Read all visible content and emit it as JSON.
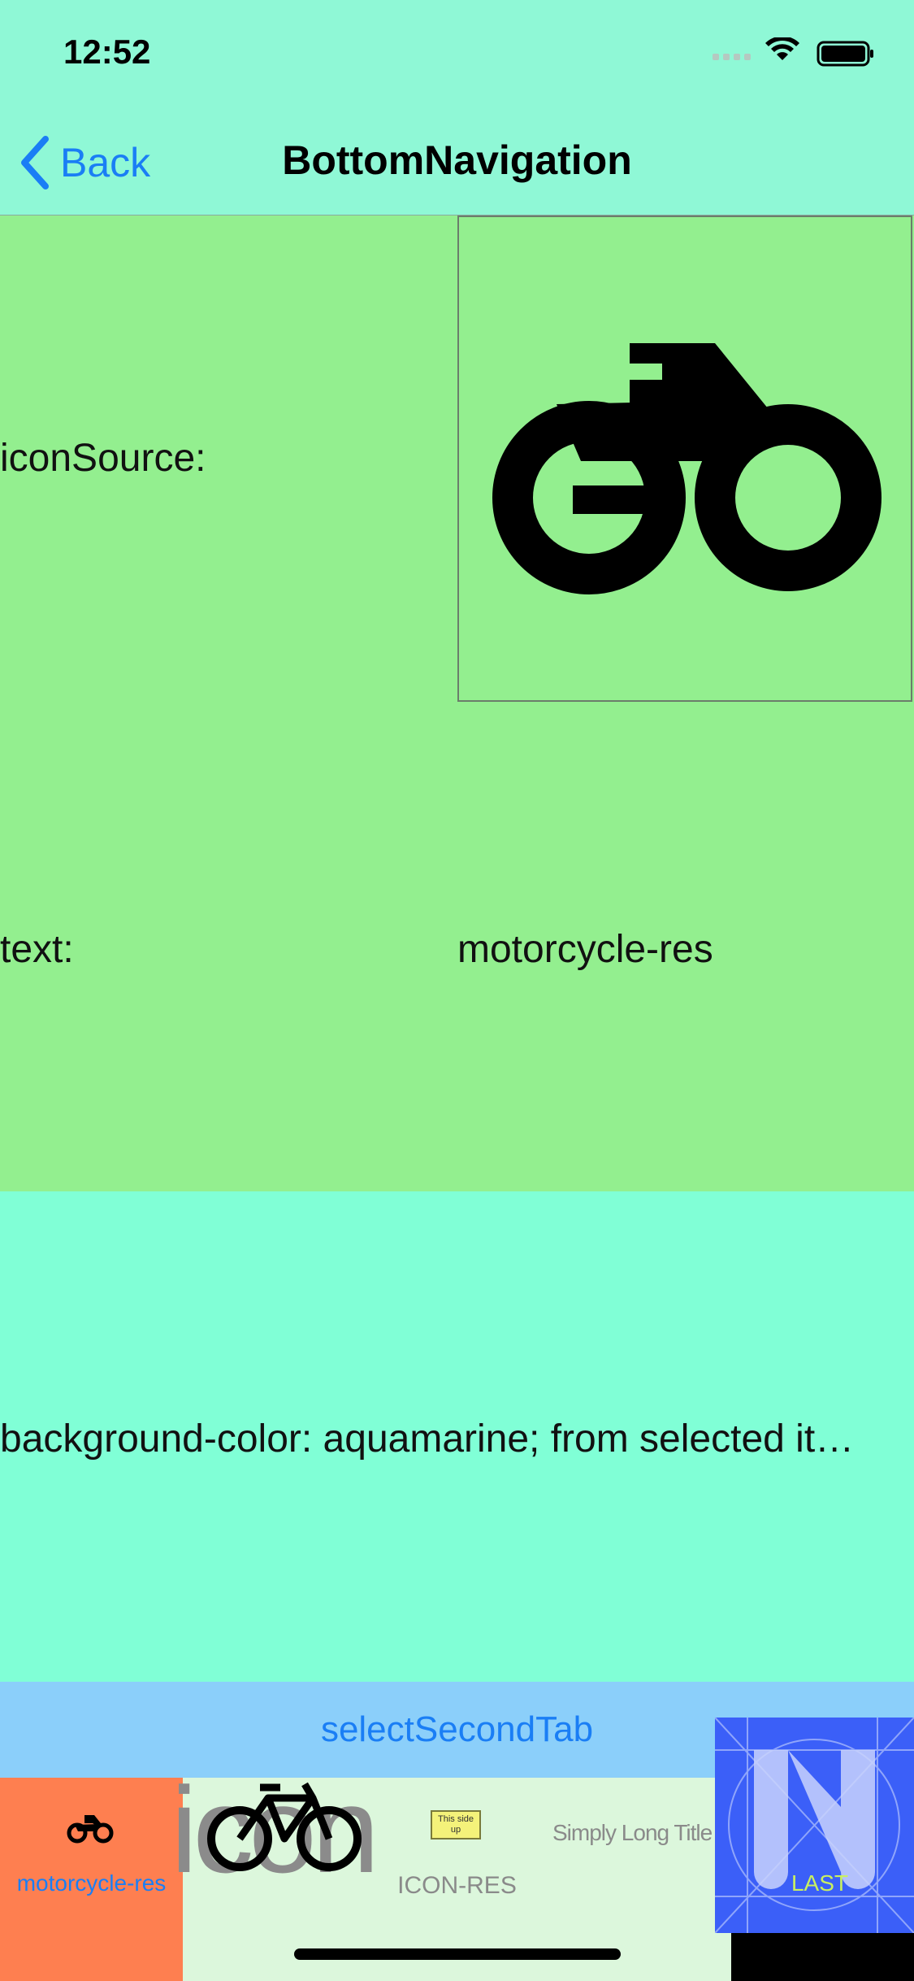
{
  "status": {
    "time": "12:52"
  },
  "nav": {
    "back_label": "Back",
    "title": "BottomNavigation"
  },
  "content": {
    "icon_source_label": "iconSource:",
    "text_label": "text:",
    "text_value": "motorcycle-res",
    "background_text": "background-color: aquamarine; from selected it…"
  },
  "select_button": {
    "label": "selectSecondTab"
  },
  "bottom_nav": {
    "tabs": [
      {
        "label": "motorcycle-res",
        "icon": "motorcycle-icon"
      },
      {
        "label": "icon",
        "icon": "bicycle-icon"
      },
      {
        "label": "ICON-RES",
        "icon": "this-side-up-icon",
        "icon_text": "This side up"
      },
      {
        "label": "Simply Long Title",
        "icon": ""
      },
      {
        "label": "LAST",
        "icon": "nativescript-logo"
      }
    ]
  },
  "colors": {
    "nav_background": "#8ff8d6",
    "grid_background": "#93ef8f",
    "selected_background": "#80ffd6",
    "button_bar": "#8bcffa",
    "tab1_background": "#fe7f50",
    "tab5_background": "#3b5ff8",
    "accent": "#1a7ef5"
  }
}
